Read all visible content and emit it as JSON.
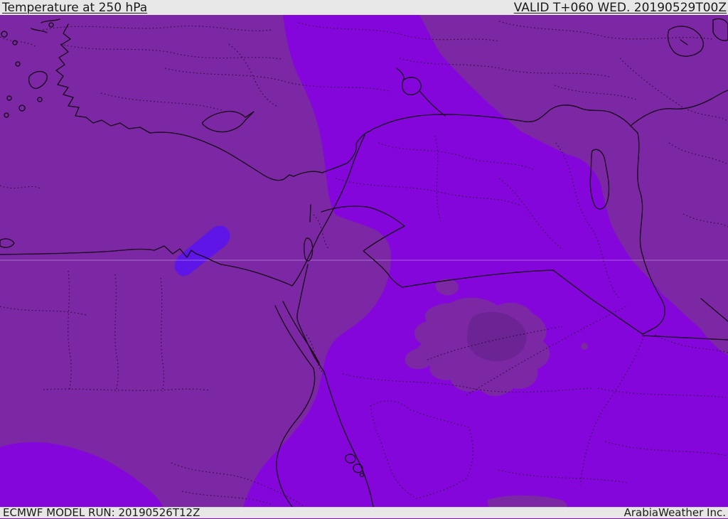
{
  "header": {
    "title": "Temperature at 250 hPa",
    "valid_label": "VALID T+060 WED. 20190529T00Z"
  },
  "footer": {
    "model_run_label": "ECMWF MODEL RUN: 20190526T12Z",
    "credit_label": "ArabiaWeather Inc."
  },
  "map": {
    "gridline_y": "366",
    "colors": {
      "band_bright": "#8406DB",
      "band_muted": "#7C28A4",
      "band_dark": "#6C2394",
      "band_streak": "#5F15E6",
      "coastline": "#150317",
      "admin": "#23062A",
      "gridline": "#C9B6E8",
      "header_bg": "#E7E7E7",
      "text": "#1A1A1A"
    }
  }
}
